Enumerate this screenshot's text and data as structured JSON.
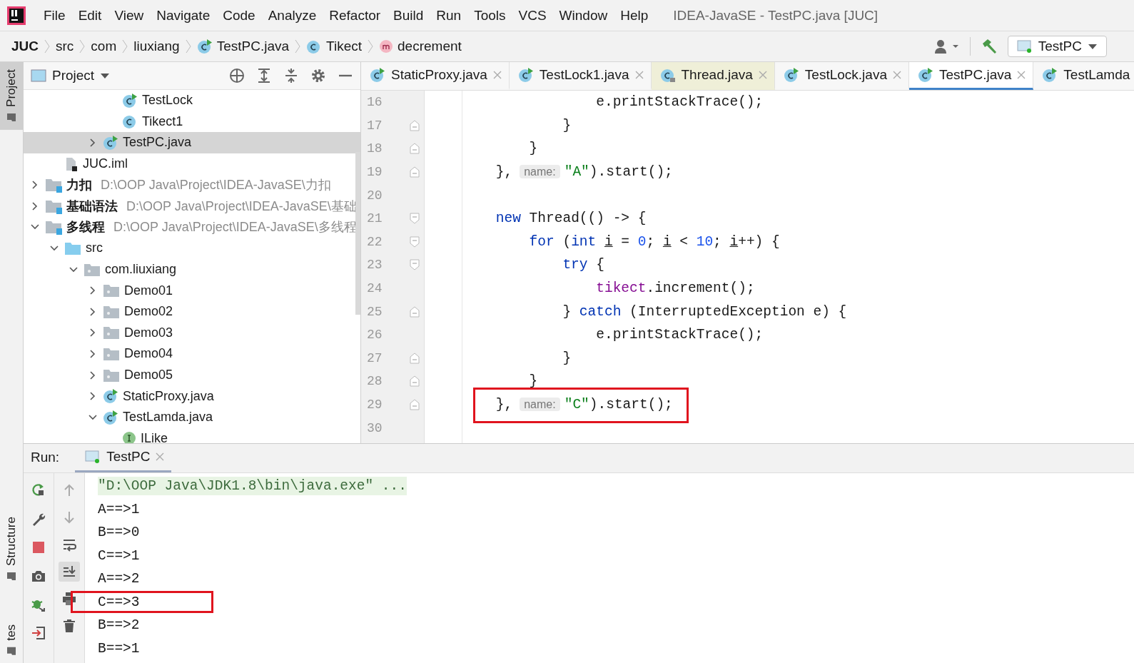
{
  "menu_bar": {
    "items": [
      "File",
      "Edit",
      "View",
      "Navigate",
      "Code",
      "Analyze",
      "Refactor",
      "Build",
      "Run",
      "Tools",
      "VCS",
      "Window",
      "Help"
    ],
    "title": "IDEA-JavaSE - TestPC.java [JUC]"
  },
  "navigation_bar": {
    "breadcrumbs": [
      {
        "label": "JUC",
        "bold": true
      },
      {
        "label": "src",
        "bold": false
      },
      {
        "label": "com",
        "bold": false
      },
      {
        "label": "liuxiang",
        "bold": false
      },
      {
        "label": "TestPC.java",
        "kind": "class-run",
        "bold": false
      },
      {
        "label": "Tikect",
        "kind": "class",
        "bold": false
      },
      {
        "label": "decrement",
        "kind": "method",
        "bold": false
      }
    ],
    "run_configuration": "TestPC"
  },
  "tool_window_strip": {
    "tabs": [
      {
        "label": "Project",
        "selected": true
      },
      {
        "label": "Structure",
        "selected": false
      },
      {
        "label": "tes",
        "selected": false
      }
    ]
  },
  "project_panel": {
    "title": "Project",
    "tree": [
      {
        "children": [
          {
            "children": [
              {
                "children": [
                  {
                    "children": [
                      {
                        "label": "TestLock",
                        "kind": "class-run",
                        "selected": false
                      },
                      {
                        "label": "Tikect1",
                        "kind": "class",
                        "selected": false
                      }
                    ]
                  },
                  {
                    "label": "TestPC.java",
                    "kind": "class-run",
                    "expanded": false,
                    "selected": true
                  }
                ]
              }
            ]
          },
          {
            "label": "JUC.iml",
            "kind": "iml",
            "selected": false
          }
        ]
      },
      {
        "label": "力扣",
        "path": "D:\\OOP Java\\Project\\IDEA-JavaSE\\力扣",
        "kind": "module",
        "expanded": false,
        "selected": false
      },
      {
        "label": "基础语法",
        "path": "D:\\OOP Java\\Project\\IDEA-JavaSE\\基础",
        "kind": "module",
        "expanded": false,
        "selected": false
      },
      {
        "label": "多线程",
        "path": "D:\\OOP Java\\Project\\IDEA-JavaSE\\多线程",
        "kind": "module",
        "expanded": true,
        "selected": false,
        "children": [
          {
            "label": "src",
            "kind": "source",
            "expanded": true,
            "selected": false,
            "children": [
              {
                "label": "com.liuxiang",
                "kind": "package",
                "expanded": true,
                "selected": false,
                "children": [
                  {
                    "label": "Demo01",
                    "kind": "package",
                    "expanded": false,
                    "selected": false
                  },
                  {
                    "label": "Demo02",
                    "kind": "package",
                    "expanded": false,
                    "selected": false
                  },
                  {
                    "label": "Demo03",
                    "kind": "package",
                    "expanded": false,
                    "selected": false
                  },
                  {
                    "label": "Demo04",
                    "kind": "package",
                    "expanded": false,
                    "selected": false
                  },
                  {
                    "label": "Demo05",
                    "kind": "package",
                    "expanded": false,
                    "selected": false
                  },
                  {
                    "label": "StaticProxy.java",
                    "kind": "class-run",
                    "expanded": false,
                    "selected": false
                  },
                  {
                    "label": "TestLamda.java",
                    "kind": "class-run",
                    "expanded": true,
                    "selected": false,
                    "children": [
                      {
                        "label": "ILike",
                        "kind": "interface",
                        "selected": false
                      }
                    ]
                  }
                ]
              }
            ]
          }
        ]
      }
    ]
  },
  "editor": {
    "tabs": [
      {
        "label": "StaticProxy.java",
        "kind": "class-run",
        "selected": false
      },
      {
        "label": "TestLock1.java",
        "kind": "class-run",
        "selected": false
      },
      {
        "label": "Thread.java",
        "kind": "class-locked",
        "selected": false
      },
      {
        "label": "TestLock.java",
        "kind": "class-run",
        "selected": false
      },
      {
        "label": "TestPC.java",
        "kind": "class-run",
        "selected": true
      },
      {
        "label": "TestLamda",
        "kind": "class-run",
        "selected": false
      }
    ],
    "lines": [
      {
        "number": "16",
        "tokens": [
          {
            "text": "                e.printStackTrace();",
            "kind": "plain"
          }
        ]
      },
      {
        "number": "17",
        "kind": "fold-end",
        "tokens": [
          {
            "text": "            }",
            "kind": "plain"
          }
        ]
      },
      {
        "number": "18",
        "kind": "fold-end",
        "tokens": [
          {
            "text": "        }",
            "kind": "plain"
          }
        ]
      },
      {
        "number": "19",
        "kind": "fold-end",
        "tokens": [
          {
            "text": "    },",
            "kind": "plain"
          },
          {
            "text": "name:",
            "kind": "hint"
          },
          {
            "text": "\"A\"",
            "kind": "string"
          },
          {
            "text": ").start();",
            "kind": "plain"
          }
        ]
      },
      {
        "number": "20"
      },
      {
        "number": "21",
        "kind": "fold-start",
        "tokens": [
          {
            "text": "    new",
            "kind": "keyword"
          },
          {
            "text": " Thread(() -> {",
            "kind": "plain"
          }
        ]
      },
      {
        "number": "22",
        "kind": "fold-start",
        "tokens": [
          {
            "text": "        for",
            "kind": "keyword"
          },
          {
            "text": " (",
            "kind": "plain"
          },
          {
            "text": "int ",
            "kind": "keyword"
          },
          {
            "text": "i",
            "kind": "variable"
          },
          {
            "text": " = ",
            "kind": "plain"
          },
          {
            "text": "0",
            "kind": "number"
          },
          {
            "text": "; ",
            "kind": "plain"
          },
          {
            "text": "i",
            "kind": "variable"
          },
          {
            "text": " < ",
            "kind": "plain"
          },
          {
            "text": "10",
            "kind": "number"
          },
          {
            "text": "; ",
            "kind": "plain"
          },
          {
            "text": "i",
            "kind": "variable"
          },
          {
            "text": "++) {",
            "kind": "plain"
          }
        ]
      },
      {
        "number": "23",
        "kind": "fold-start",
        "tokens": [
          {
            "text": "            try",
            "kind": "keyword"
          },
          {
            "text": " {",
            "kind": "plain"
          }
        ]
      },
      {
        "number": "24",
        "tokens": [
          {
            "text": "                tikect",
            "kind": "field"
          },
          {
            "text": ".increment();",
            "kind": "plain"
          }
        ]
      },
      {
        "number": "25",
        "kind": "fold-end",
        "tokens": [
          {
            "text": "            } ",
            "kind": "plain"
          },
          {
            "text": "catch",
            "kind": "keyword"
          },
          {
            "text": " (InterruptedException e) {",
            "kind": "plain"
          }
        ]
      },
      {
        "number": "26",
        "tokens": [
          {
            "text": "                e.printStackTrace();",
            "kind": "plain"
          }
        ]
      },
      {
        "number": "27",
        "kind": "fold-end",
        "tokens": [
          {
            "text": "            }",
            "kind": "plain"
          }
        ]
      },
      {
        "number": "28",
        "kind": "fold-end",
        "tokens": [
          {
            "text": "        }",
            "kind": "plain"
          }
        ]
      },
      {
        "number": "29",
        "kind": "fold-end",
        "annotated": true,
        "tokens": [
          {
            "text": "    },",
            "kind": "plain"
          },
          {
            "text": "name:",
            "kind": "hint"
          },
          {
            "text": "\"C\"",
            "kind": "string"
          },
          {
            "text": ").start();",
            "kind": "plain"
          }
        ]
      },
      {
        "number": "30"
      }
    ]
  },
  "run_panel": {
    "label": "Run:",
    "tabs": [
      {
        "label": "TestPC",
        "selected": true
      }
    ],
    "console": [
      {
        "text": "\"D:\\OOP Java\\JDK1.8\\bin\\java.exe\" ...",
        "kind": "command"
      },
      {
        "text": "A==>1",
        "kind": "output"
      },
      {
        "text": "B==>0",
        "kind": "output"
      },
      {
        "text": "C==>1",
        "kind": "output"
      },
      {
        "text": "A==>2",
        "kind": "output"
      },
      {
        "text": "C==>3",
        "kind": "output",
        "annotated": true
      },
      {
        "text": "B==>2",
        "kind": "output"
      },
      {
        "text": "B==>1",
        "kind": "output"
      }
    ]
  }
}
